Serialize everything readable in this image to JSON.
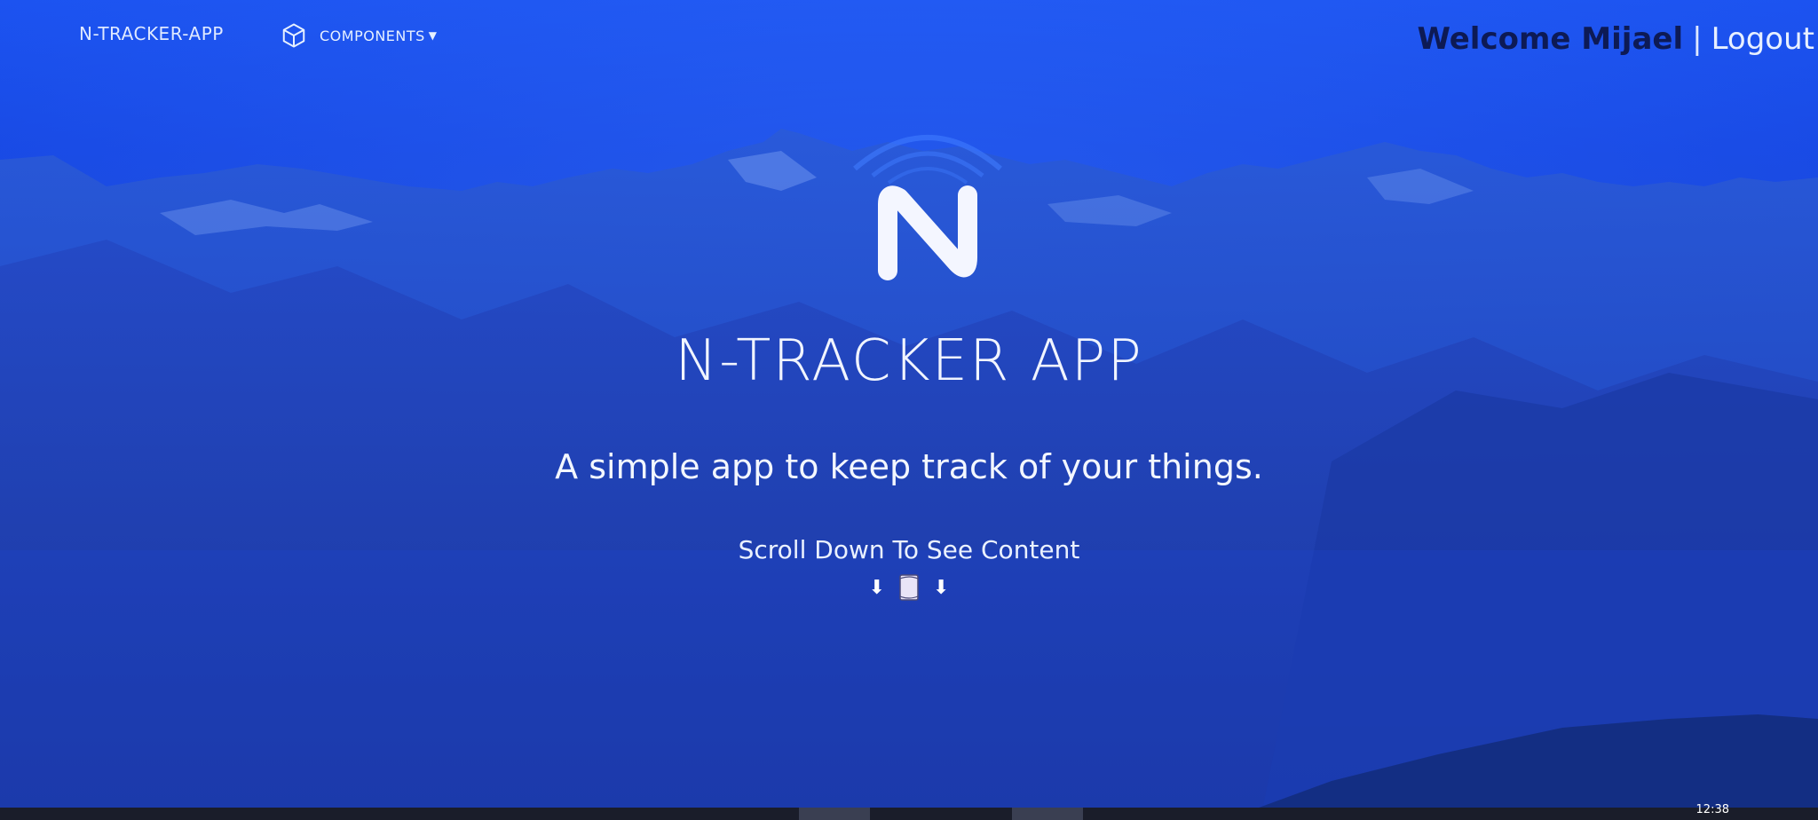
{
  "navbar": {
    "brand": "N-TRACKER-APP",
    "components_label": "COMPONENTS",
    "components_icon": "cube-icon",
    "caret_icon": "caret-down-icon",
    "welcome_text": "Welcome Mijael",
    "separator": "|",
    "logout_label": "Logout"
  },
  "hero": {
    "logo_icon": "n-logo-icon",
    "title": "N-TRACKER APP",
    "subtitle": "A simple app to keep track of your things.",
    "scroll_hint": "Scroll Down To See Content",
    "arrow_left": "⬇",
    "arrow_right": "⬇",
    "scroll_icon": "scroll-icon"
  },
  "taskbar": {
    "clock": "12:38"
  },
  "colors": {
    "background": "#1a4fe0",
    "welcome_name": "#0d1a55",
    "text": "#ffffff"
  }
}
